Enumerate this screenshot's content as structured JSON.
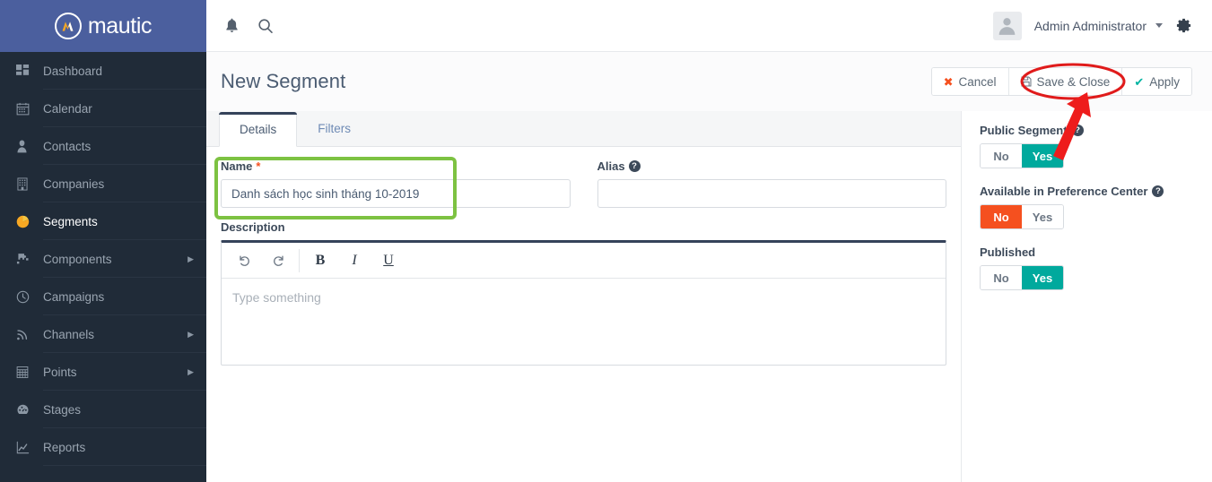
{
  "brand": {
    "name": "mautic",
    "logo_icon": "mautic-m-logo",
    "bg": "#4b5f9e"
  },
  "sidebar": {
    "items": [
      {
        "label": "Dashboard",
        "icon": "grid-icon",
        "active": false,
        "caret": false
      },
      {
        "label": "Calendar",
        "icon": "calendar-icon",
        "active": false,
        "caret": false
      },
      {
        "label": "Contacts",
        "icon": "user-icon",
        "active": false,
        "caret": false
      },
      {
        "label": "Companies",
        "icon": "building-icon",
        "active": false,
        "caret": false
      },
      {
        "label": "Segments",
        "icon": "pie-chart-icon",
        "active": true,
        "caret": false
      },
      {
        "label": "Components",
        "icon": "puzzle-icon",
        "active": false,
        "caret": true
      },
      {
        "label": "Campaigns",
        "icon": "clock-icon",
        "active": false,
        "caret": false
      },
      {
        "label": "Channels",
        "icon": "rss-icon",
        "active": false,
        "caret": true
      },
      {
        "label": "Points",
        "icon": "table-icon",
        "active": false,
        "caret": true
      },
      {
        "label": "Stages",
        "icon": "speedometer-icon",
        "active": false,
        "caret": false
      },
      {
        "label": "Reports",
        "icon": "line-chart-icon",
        "active": false,
        "caret": false
      }
    ]
  },
  "topbar": {
    "notifications_icon": "bell-icon",
    "search_icon": "search-icon",
    "avatar_icon": "avatar-icon",
    "user_name": "Admin Administrator",
    "user_caret_icon": "chevron-down-icon",
    "settings_icon": "gear-icon"
  },
  "page": {
    "title": "New Segment",
    "actions": {
      "cancel_label": "Cancel",
      "cancel_icon": "x-icon",
      "save_close_label": "Save & Close",
      "save_close_icon": "floppy-disk-icon",
      "apply_label": "Apply",
      "apply_icon": "check-icon"
    }
  },
  "tabs": [
    {
      "label": "Details",
      "active": true
    },
    {
      "label": "Filters",
      "active": false
    }
  ],
  "form": {
    "name": {
      "label": "Name",
      "required_marker": "*",
      "value": "Danh sách học sinh tháng 10-2019",
      "placeholder": ""
    },
    "alias": {
      "label": "Alias",
      "help_icon": "question-mark-icon",
      "help_glyph": "?",
      "value": "",
      "placeholder": ""
    },
    "description": {
      "label": "Description",
      "placeholder": "Type something",
      "toolbar": [
        {
          "name": "undo-button",
          "glyph": "↺"
        },
        {
          "name": "redo-button",
          "glyph": "↻"
        },
        {
          "name": "bold-button",
          "glyph": "B"
        },
        {
          "name": "italic-button",
          "glyph": "I"
        },
        {
          "name": "underline-button",
          "glyph": "U"
        }
      ]
    }
  },
  "right_panel": {
    "groups": [
      {
        "label": "Public Segment",
        "help_glyph": "?",
        "has_help": true,
        "no_label": "No",
        "yes_label": "Yes",
        "selected": "Yes"
      },
      {
        "label": "Available in Preference Center",
        "help_glyph": "?",
        "has_help": true,
        "no_label": "No",
        "yes_label": "Yes",
        "selected": "No"
      },
      {
        "label": "Published",
        "help_glyph": "",
        "has_help": false,
        "no_label": "No",
        "yes_label": "Yes",
        "selected": "Yes"
      }
    ]
  },
  "annotations": {
    "highlight_box_color": "#7dc242",
    "ellipse_color": "#e01b1b",
    "arrow_color": "#ee1c1c",
    "highlight_target": "name-field",
    "ellipse_target": "save-close-button",
    "arrow_target": "save-close-button"
  },
  "colors": {
    "brand_blue": "#4b5f9e",
    "sidebar_dark": "#202b38",
    "teal": "#00a99d",
    "orange": "#f5501f",
    "accent_yellow": "#f7a823"
  }
}
